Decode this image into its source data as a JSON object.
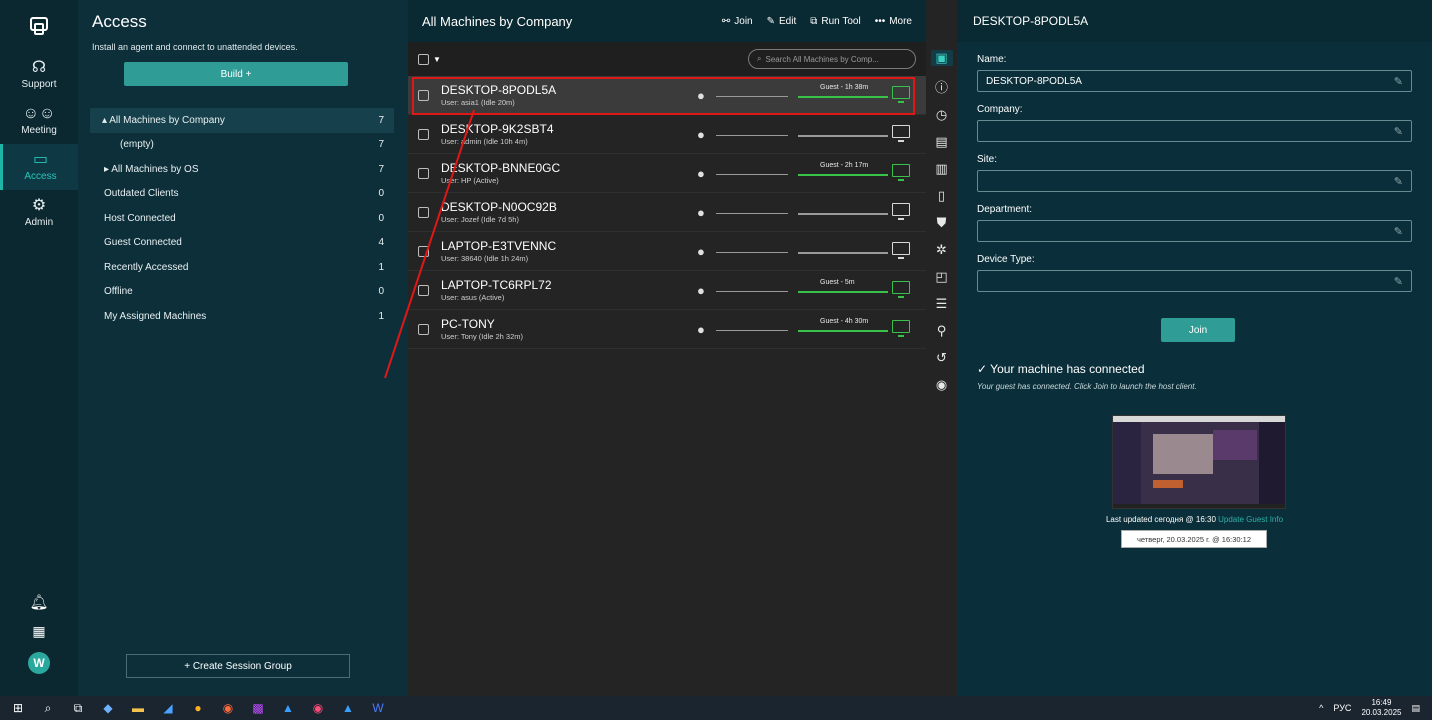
{
  "rail": {
    "items": [
      {
        "label": "Support",
        "icon": "headset-icon"
      },
      {
        "label": "Meeting",
        "icon": "users-icon"
      },
      {
        "label": "Access",
        "icon": "monitor-icon",
        "active": true
      },
      {
        "label": "Admin",
        "icon": "gear-icon"
      }
    ],
    "avatar": "W"
  },
  "access": {
    "title": "Access",
    "subtitle": "Install an agent and connect to unattended devices.",
    "build_label": "Build +",
    "groups": [
      {
        "label": "▴ All Machines by Company",
        "count": "7",
        "selected": true
      },
      {
        "label": "(empty)",
        "count": "7"
      },
      {
        "label": "▸ All Machines by OS",
        "count": "7"
      },
      {
        "label": "Outdated Clients",
        "count": "0"
      },
      {
        "label": "Host Connected",
        "count": "0"
      },
      {
        "label": "Guest Connected",
        "count": "4"
      },
      {
        "label": "Recently Accessed",
        "count": "1"
      },
      {
        "label": "Offline",
        "count": "0"
      },
      {
        "label": "My Assigned Machines",
        "count": "1"
      }
    ],
    "create_label": "+ Create Session Group"
  },
  "list": {
    "title": "All Machines by Company",
    "actions": {
      "join": "Join",
      "edit": "Edit",
      "run_tool": "Run Tool",
      "more": "More"
    },
    "search_placeholder": "Search All Machines by Comp...",
    "machines": [
      {
        "name": "DESKTOP-8PODL5A",
        "user": "User: asia1 (Idle 20m)",
        "guest": "Guest - 1h 38m",
        "connected": true
      },
      {
        "name": "DESKTOP-9K2SBT4",
        "user": "User: admin (Idle 10h 4m)",
        "guest": "",
        "connected": false
      },
      {
        "name": "DESKTOP-BNNE0GC",
        "user": "User: HP (Active)",
        "guest": "Guest - 2h 17m",
        "connected": true
      },
      {
        "name": "DESKTOP-N0OC92B",
        "user": "User: Jozef (Idle 7d 5h)",
        "guest": "",
        "connected": false
      },
      {
        "name": "LAPTOP-E3TVENNC",
        "user": "User: 38640 (Idle 1h 24m)",
        "guest": "",
        "connected": false
      },
      {
        "name": "LAPTOP-TC6RPL72",
        "user": "User: asus (Active)",
        "guest": "Guest - 5m",
        "connected": true
      },
      {
        "name": "PC-TONY",
        "user": "User: Tony (Idle 2h 32m)",
        "guest": "Guest - 4h 30m",
        "connected": true
      }
    ]
  },
  "details": {
    "title": "DESKTOP-8PODL5A",
    "fields": [
      {
        "label": "Name:",
        "value": "DESKTOP-8PODL5A"
      },
      {
        "label": "Company:",
        "value": ""
      },
      {
        "label": "Site:",
        "value": ""
      },
      {
        "label": "Department:",
        "value": ""
      },
      {
        "label": "Device Type:",
        "value": ""
      }
    ],
    "join_label": "Join",
    "connected_title": "Your machine has connected",
    "connected_sub": "Your guest has connected. Click Join to launch the host client.",
    "last_updated": "Last updated сегодня @ 16:30",
    "update_link": "Update Guest Info",
    "tooltip": "четверг, 20.03.2025 г. @ 16:30:12"
  },
  "taskbar": {
    "lang": "РУС",
    "time": "16:49",
    "date": "20.03.2025"
  }
}
